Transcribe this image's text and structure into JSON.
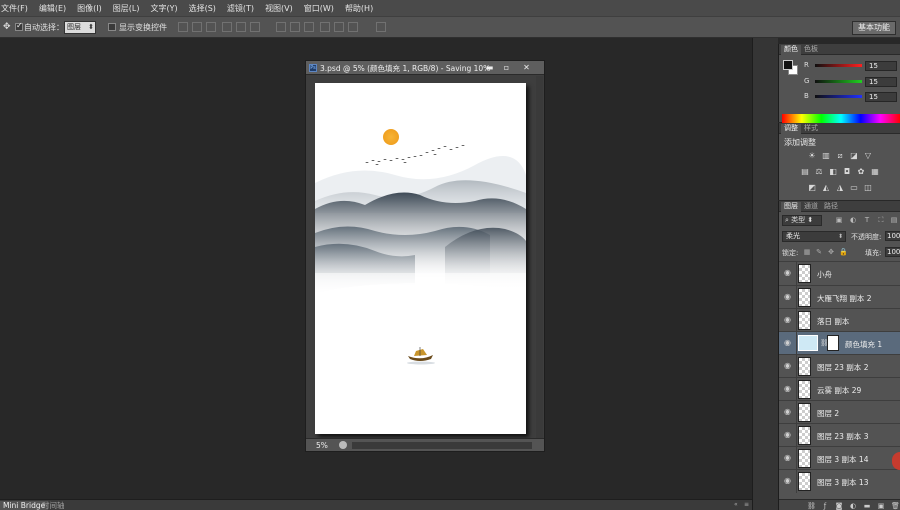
{
  "menu": [
    "文件(F)",
    "编辑(E)",
    "图像(I)",
    "图层(L)",
    "文字(Y)",
    "选择(S)",
    "滤镜(T)",
    "视图(V)",
    "窗口(W)",
    "帮助(H)"
  ],
  "options": {
    "auto_select_label": "自动选择：",
    "auto_select_target": "图层",
    "show_transform_label": "显示变换控件",
    "workspace": "基本功能"
  },
  "document": {
    "title": "3.psd @ 5% (颜色填充 1, RGB/8) - Saving 10%",
    "zoom": "5%"
  },
  "bottom_tabs": [
    "Mini Bridge",
    "时间轴"
  ],
  "color_panel": {
    "tabs": [
      "颜色",
      "色板"
    ],
    "channels": [
      {
        "label": "R",
        "value": "15",
        "color": "#ff3030"
      },
      {
        "label": "G",
        "value": "15",
        "color": "#30d030"
      },
      {
        "label": "B",
        "value": "15",
        "color": "#3040ff"
      }
    ]
  },
  "adjust_panel": {
    "tabs": [
      "调整",
      "样式"
    ],
    "title": "添加调整"
  },
  "layers_panel": {
    "tabs": [
      "图层",
      "通道",
      "路径"
    ],
    "filter": "类型",
    "blend_mode": "柔光",
    "opacity_label": "不透明度:",
    "opacity_value": "100%",
    "lock_label": "锁定:",
    "fill_label": "填充:",
    "fill_value": "100%",
    "layers": [
      {
        "name": "小舟",
        "type": "pixel",
        "selected": false
      },
      {
        "name": "大雁飞翔 副本 2",
        "type": "pixel",
        "selected": false
      },
      {
        "name": "落日  副本",
        "type": "pixel",
        "selected": false
      },
      {
        "name": "颜色填充 1",
        "type": "fill",
        "selected": true
      },
      {
        "name": "图层 23 副本 2",
        "type": "pixel",
        "selected": false
      },
      {
        "name": "云雾 副本 29",
        "type": "pixel",
        "selected": false
      },
      {
        "name": "图层 2",
        "type": "pixel",
        "selected": false
      },
      {
        "name": "图层 23 副本 3",
        "type": "pixel",
        "selected": false
      },
      {
        "name": "图层 3 副本 14",
        "type": "pixel",
        "selected": false
      },
      {
        "name": "图层 3 副本 13",
        "type": "pixel",
        "selected": false
      }
    ]
  }
}
